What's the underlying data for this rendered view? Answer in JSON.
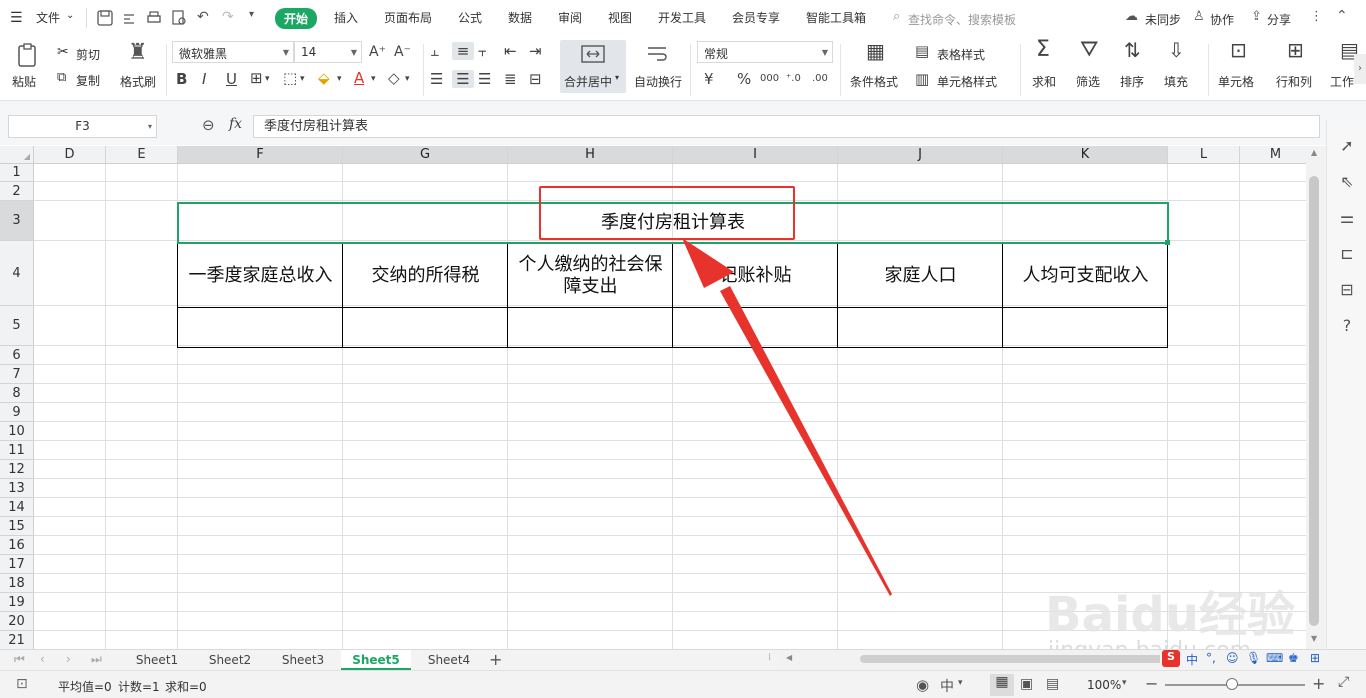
{
  "menu": {
    "file": "文件",
    "tabs": [
      "开始",
      "插入",
      "页面布局",
      "公式",
      "数据",
      "审阅",
      "视图",
      "开发工具",
      "会员专享",
      "智能工具箱"
    ],
    "active_tab": "开始",
    "search_placeholder": "查找命令、搜索模板",
    "sync": "未同步",
    "collab": "协作",
    "share": "分享"
  },
  "ribbon": {
    "paste": "粘贴",
    "cut": "剪切",
    "copy": "复制",
    "format_painter": "格式刷",
    "font_name": "微软雅黑",
    "font_size": "14",
    "merge_center": "合并居中",
    "wrap_text": "自动换行",
    "number_format": "常规",
    "conditional_format": "条件格式",
    "table_style": "表格样式",
    "cell_style": "单元格样式",
    "sum": "求和",
    "filter": "筛选",
    "sort": "排序",
    "fill": "填充",
    "cell": "单元格",
    "row_col": "行和列",
    "worksheet": "工作"
  },
  "formula_bar": {
    "name_box": "F3",
    "fx": "fx",
    "content": "季度付房租计算表"
  },
  "columns": [
    "D",
    "E",
    "F",
    "G",
    "H",
    "I",
    "J",
    "K",
    "L",
    "M"
  ],
  "rows": [
    "1",
    "2",
    "3",
    "4",
    "5",
    "6",
    "7",
    "8",
    "9",
    "10",
    "11",
    "12",
    "13",
    "14",
    "15",
    "16",
    "17",
    "18",
    "19",
    "20",
    "21"
  ],
  "table": {
    "title": "季度付房租计算表",
    "headers": [
      "一季度家庭总收入",
      "交纳的所得税",
      "个人缴纳的社会保障支出",
      "记账补贴",
      "家庭人口",
      "人均可支配收入"
    ]
  },
  "sheets": [
    "Sheet1",
    "Sheet2",
    "Sheet3",
    "Sheet5",
    "Sheet4"
  ],
  "active_sheet": "Sheet5",
  "status": {
    "average": "平均值=0",
    "count": "计数=1",
    "sum": "求和=0",
    "zoom": "100%"
  },
  "watermark": {
    "brand": "Baidu经验",
    "url": "jingyan.baidu.com"
  },
  "colors": {
    "accent": "#1ba864",
    "annotation": "#e8322c",
    "selection": "#21a366"
  }
}
